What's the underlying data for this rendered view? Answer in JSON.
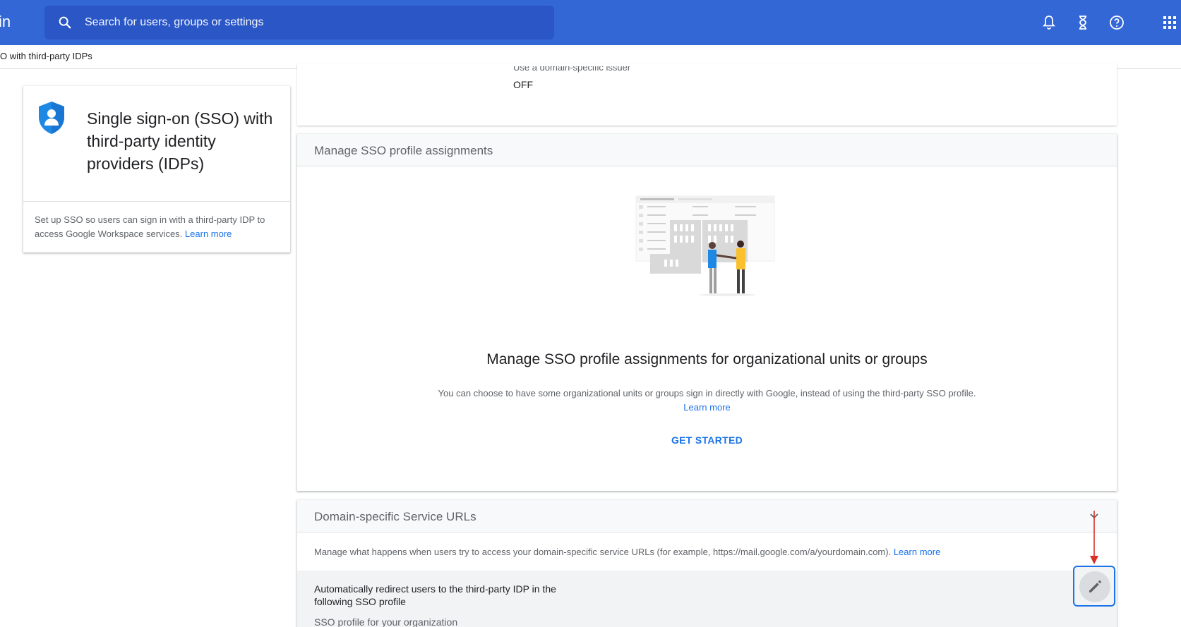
{
  "header": {
    "brand_partial": "in",
    "search_placeholder": "Search for users, groups or settings",
    "icons": [
      "search-icon",
      "bell-icon",
      "hourglass-icon",
      "help-icon",
      "apps-grid-icon"
    ],
    "bar_color": "#3367d6"
  },
  "breadcrumb": {
    "text": "O with third-party IDPs"
  },
  "info_card": {
    "title": "Single sign-on (SSO) with third-party identity providers (IDPs)",
    "description": "Set up SSO so users can sign in with a third-party IDP to access Google Workspace services.",
    "learn_more": "Learn more",
    "icon": "shield-person-icon"
  },
  "issuer": {
    "label": "Use a domain-specific issuer",
    "value": "OFF"
  },
  "manage_sso": {
    "header": "Manage SSO profile assignments",
    "title": "Manage SSO profile assignments for organizational units or groups",
    "description": "You can choose to have some organizational units or groups sign in directly with Google, instead of using the third-party SSO profile.",
    "learn_more": "Learn more",
    "cta": "GET STARTED"
  },
  "domain_urls": {
    "header": "Domain-specific Service URLs",
    "description": "Manage what happens when users try to access your domain-specific service URLs (for example, https://mail.google.com/a/yourdomain.com).",
    "learn_more": "Learn more",
    "redirect_title": "Automatically redirect users to the third-party IDP in the following SSO profile",
    "redirect_sub": "SSO profile for your organization"
  },
  "colors": {
    "accent": "#1a73e8",
    "annotation_arrow": "#d93025"
  }
}
